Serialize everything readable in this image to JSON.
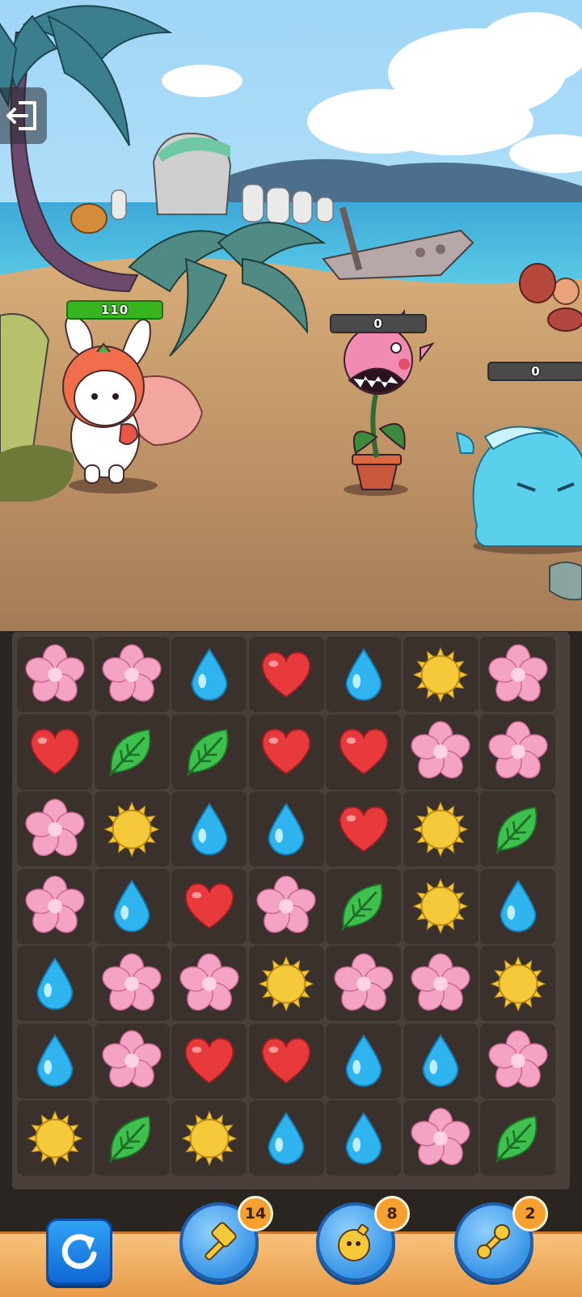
{
  "hud": {
    "exit_icon": "exit-door-icon",
    "player": {
      "name": "strawberry-bunny",
      "hp": "110"
    },
    "enemies": [
      {
        "name": "pink-piranha-plant",
        "hp": "0"
      },
      {
        "name": "blue-jelly-slime",
        "hp": "0"
      }
    ]
  },
  "board": {
    "rows": 7,
    "cols": 7,
    "tiles": [
      [
        "flower",
        "flower",
        "water",
        "heart",
        "water",
        "sun",
        "flower"
      ],
      [
        "heart",
        "leaf",
        "leaf",
        "heart",
        "heart",
        "flower",
        "flower"
      ],
      [
        "flower",
        "sun",
        "water",
        "water",
        "heart",
        "sun",
        "leaf"
      ],
      [
        "flower",
        "water",
        "heart",
        "flower",
        "leaf",
        "sun",
        "water"
      ],
      [
        "water",
        "flower",
        "flower",
        "sun",
        "flower",
        "flower",
        "sun"
      ],
      [
        "water",
        "flower",
        "heart",
        "heart",
        "water",
        "water",
        "flower"
      ],
      [
        "sun",
        "leaf",
        "sun",
        "water",
        "water",
        "flower",
        "leaf"
      ]
    ],
    "colors": {
      "flower": "#f4a3c4",
      "water": "#2fb4f0",
      "heart": "#e83a3d",
      "sun": "#f6c93a",
      "leaf": "#3fbf4d"
    }
  },
  "toolbar": {
    "refresh": {
      "icon": "refresh-icon"
    },
    "boosters": [
      {
        "icon": "hammer-icon",
        "count": "14"
      },
      {
        "icon": "bomb-icon",
        "count": "8"
      },
      {
        "icon": "drill-icon",
        "count": "2"
      }
    ]
  }
}
